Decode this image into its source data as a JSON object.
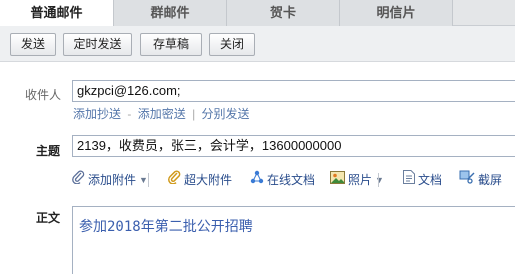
{
  "tabs": [
    {
      "label": "普通邮件",
      "active": true
    },
    {
      "label": "群邮件",
      "active": false
    },
    {
      "label": "贺卡",
      "active": false
    },
    {
      "label": "明信片",
      "active": false
    }
  ],
  "toolbar": {
    "send_label": "发送",
    "scheduled_label": "定时发送",
    "draft_label": "存草稿",
    "close_label": "关闭"
  },
  "compose": {
    "to_label": "收件人",
    "to_value": "gkzpci@126.com;",
    "cc_label": "添加抄送",
    "bcc_label": "添加密送",
    "split_label": "分别发送",
    "dash_sep": "-",
    "bar_sep": "|",
    "subject_label": "主题",
    "subject_value": "2139，收费员，张三，会计学，13600000000",
    "body_label": "正文",
    "body_value": "参加2018年第二批公开招聘"
  },
  "attachments": {
    "add_attachment": "添加附件",
    "large_attachment": "超大附件",
    "online_doc": "在线文档",
    "photo": "照片",
    "document": "文档",
    "screenshot": "截屏"
  },
  "icons": {
    "attachment": "paperclip-icon",
    "large_attachment": "paperclip-gold-icon",
    "online_doc": "share-nodes-icon",
    "photo": "photo-icon",
    "document": "document-icon",
    "screenshot": "scissors-icon"
  },
  "colors": {
    "link": "#5577aa",
    "body_text": "#3b5fae",
    "input_border": "#a5b1c2"
  }
}
